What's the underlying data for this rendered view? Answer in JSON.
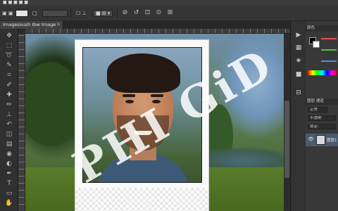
{
  "menubar": {
    "left": "■ ■ ■ ■ ■"
  },
  "options": {
    "mode": "▣ ▣",
    "item1": "□",
    "item2": "□ □ ■ ■",
    "item3": "☐ ⊥",
    "item4": "■ ⊞ ▾",
    "icons": [
      "⊘",
      "↺",
      "⊡",
      "⊙",
      "⊞"
    ]
  },
  "document": {
    "tab_label": "Imagesoush Ibw Image",
    "tab_close": "✕"
  },
  "watermark": "PHI GiD",
  "panel": {
    "tab_color": "颜色",
    "tab_layers": "图层",
    "tab_channels": "通道",
    "blend_mode": "正常",
    "opacity": "不透明",
    "lock": "锁定:",
    "layer_name": "图层1"
  },
  "colors": {
    "foreground": "#000000",
    "background": "#ffffff"
  },
  "tools": [
    "move-icon",
    "marquee-icon",
    "lasso-icon",
    "quick-select-icon",
    "crop-icon",
    "eyedropper-icon",
    "healing-icon",
    "brush-icon",
    "stamp-icon",
    "history-brush-icon",
    "eraser-icon",
    "gradient-icon",
    "blur-icon",
    "dodge-icon",
    "pen-icon",
    "type-icon",
    "path-select-icon",
    "shape-icon",
    "hand-icon",
    "zoom-icon"
  ]
}
